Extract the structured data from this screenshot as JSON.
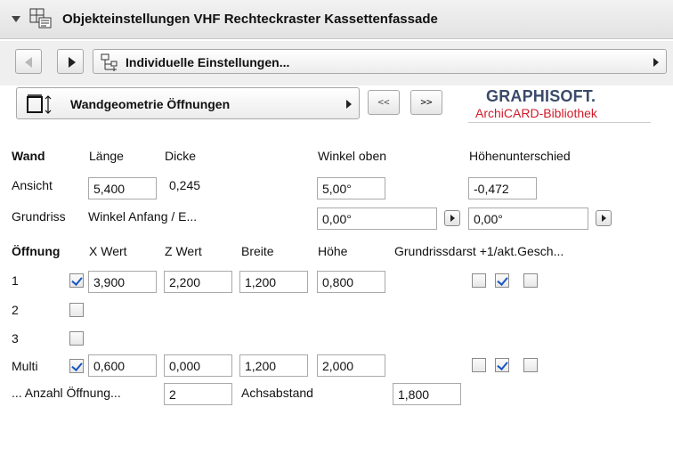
{
  "panel": {
    "title": "Objekteinstellungen VHF Rechteckraster Kassettenfassade"
  },
  "nav": {
    "settings_label": "Individuelle Einstellungen..."
  },
  "page": {
    "label": "Wandgeometrie Öffnungen",
    "prev_label": "<<",
    "next_label": ">>"
  },
  "brand": {
    "line1": "GRAPHISOFT.",
    "line2": "ArchiCARD-Bibliothek"
  },
  "wall": {
    "header": "Wand",
    "col_laenge": "Länge",
    "col_dicke": "Dicke",
    "col_winkel_oben": "Winkel oben",
    "col_hoehenunterschied": "Höhenunterschied",
    "ansicht_label": "Ansicht",
    "laenge": "5,400",
    "dicke": "0,245",
    "winkel_oben": "5,00°",
    "hoehenunterschied": "-0,472",
    "grundriss_label": "Grundriss",
    "winkel_anfang_label": "Winkel Anfang / E...",
    "winkel_anfang": "0,00°",
    "winkel_ende": "0,00°"
  },
  "openings": {
    "header": "Öffnung",
    "col_x": "X Wert",
    "col_z": "Z Wert",
    "col_breite": "Breite",
    "col_hoehe": "Höhe",
    "col_grundriss": "Grundrissdarst +1/akt.Gesch...",
    "rows": [
      {
        "label": "1",
        "enabled": true,
        "x": "3,900",
        "z": "2,200",
        "breite": "1,200",
        "hoehe": "0,800",
        "flags": [
          false,
          true,
          false
        ]
      },
      {
        "label": "2",
        "enabled": false
      },
      {
        "label": "3",
        "enabled": false
      },
      {
        "label": "Multi",
        "enabled": true,
        "x": "0,600",
        "z": "0,000",
        "breite": "1,200",
        "hoehe": "2,000",
        "flags": [
          false,
          true,
          false
        ]
      }
    ],
    "anzahl_label": "... Anzahl Öffnung...",
    "anzahl": "2",
    "achsabstand_label": "Achsabstand",
    "achsabstand": "1,800"
  }
}
